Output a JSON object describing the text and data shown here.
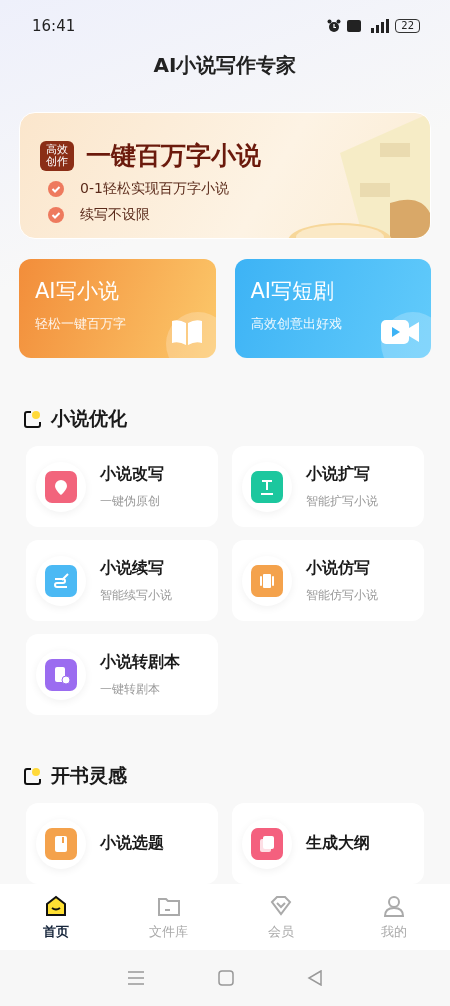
{
  "status_bar": {
    "time": "16:41",
    "battery": "22"
  },
  "title": "AI小说写作专家",
  "banner": {
    "badge": "高效创作",
    "headline": "一键百万字小说",
    "points": [
      "0-1轻松实现百万字小说",
      "续写不设限"
    ]
  },
  "big_cards": [
    {
      "title": "AI写小说",
      "subtitle": "轻松一键百万字",
      "kind": "novel"
    },
    {
      "title": "AI写短剧",
      "subtitle": "高效创意出好戏",
      "kind": "drama"
    }
  ],
  "sections": [
    {
      "title": "小说优化",
      "items": [
        {
          "title": "小说改写",
          "subtitle": "一键伪原创",
          "color": "#f2647c"
        },
        {
          "title": "小说扩写",
          "subtitle": "智能扩写小说",
          "color": "#1cc79e"
        },
        {
          "title": "小说续写",
          "subtitle": "智能续写小说",
          "color": "#4bb9f4"
        },
        {
          "title": "小说仿写",
          "subtitle": "智能仿写小说",
          "color": "#f4a24c"
        },
        {
          "title": "小说转剧本",
          "subtitle": "一键转剧本",
          "color": "#9b6cf0"
        }
      ]
    },
    {
      "title": "开书灵感",
      "items": [
        {
          "title": "小说选题",
          "color": "#f4a24c"
        },
        {
          "title": "生成大纲",
          "color": "#f4607e"
        }
      ]
    }
  ],
  "tab_bar": [
    {
      "label": "首页",
      "selected": true
    },
    {
      "label": "文件库",
      "selected": false
    },
    {
      "label": "会员",
      "selected": false
    },
    {
      "label": "我的",
      "selected": false
    }
  ]
}
